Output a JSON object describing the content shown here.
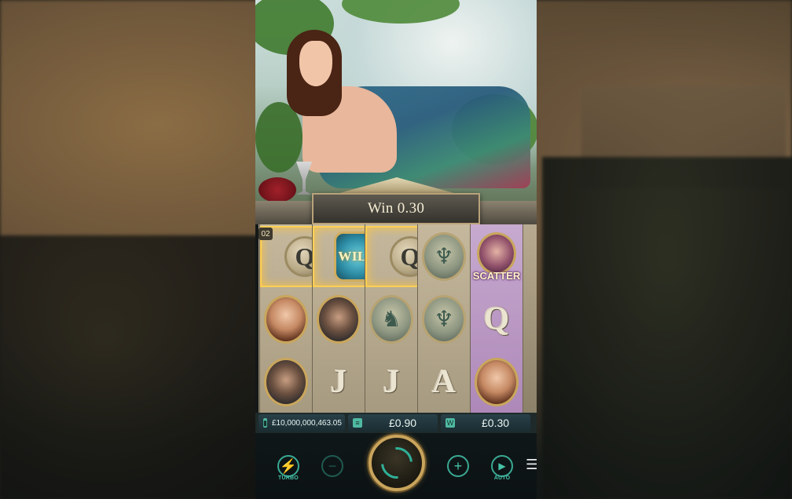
{
  "win_banner": {
    "label": "Win",
    "amount": "0.30"
  },
  "multiplier": "02",
  "reels": [
    [
      {
        "symbol": "Q",
        "kind": "coin",
        "winning": true
      },
      {
        "symbol": "woman",
        "kind": "portrait"
      },
      {
        "symbol": "man",
        "kind": "portrait"
      }
    ],
    [
      {
        "symbol": "WILD",
        "kind": "wild",
        "winning": true
      },
      {
        "symbol": "man",
        "kind": "portrait"
      },
      {
        "symbol": "J",
        "kind": "letter"
      }
    ],
    [
      {
        "symbol": "Q",
        "kind": "coin",
        "winning": true
      },
      {
        "symbol": "pegasus",
        "kind": "portrait"
      },
      {
        "symbol": "J",
        "kind": "letter"
      }
    ],
    [
      {
        "symbol": "lyre",
        "kind": "portrait"
      },
      {
        "symbol": "lyre",
        "kind": "portrait"
      },
      {
        "symbol": "A",
        "kind": "letter"
      }
    ],
    [
      {
        "symbol": "SCATTER",
        "kind": "scatter"
      },
      {
        "symbol": "Q",
        "kind": "letter"
      },
      {
        "symbol": "woman",
        "kind": "portrait"
      }
    ]
  ],
  "info": {
    "balance": "£10,000,000,463.05",
    "bet": "£0.90",
    "win": "£0.30"
  },
  "controls": {
    "turbo_label": "TURBO",
    "auto_label": "AUTO",
    "minus_glyph": "−",
    "plus_glyph": "+",
    "menu_glyph": "☰",
    "turbo_glyph": "⚡",
    "auto_glyph": "▶"
  },
  "colors": {
    "accent": "#45c2a7",
    "gold": "#c9a45c",
    "win_glow": "#ffd056"
  }
}
